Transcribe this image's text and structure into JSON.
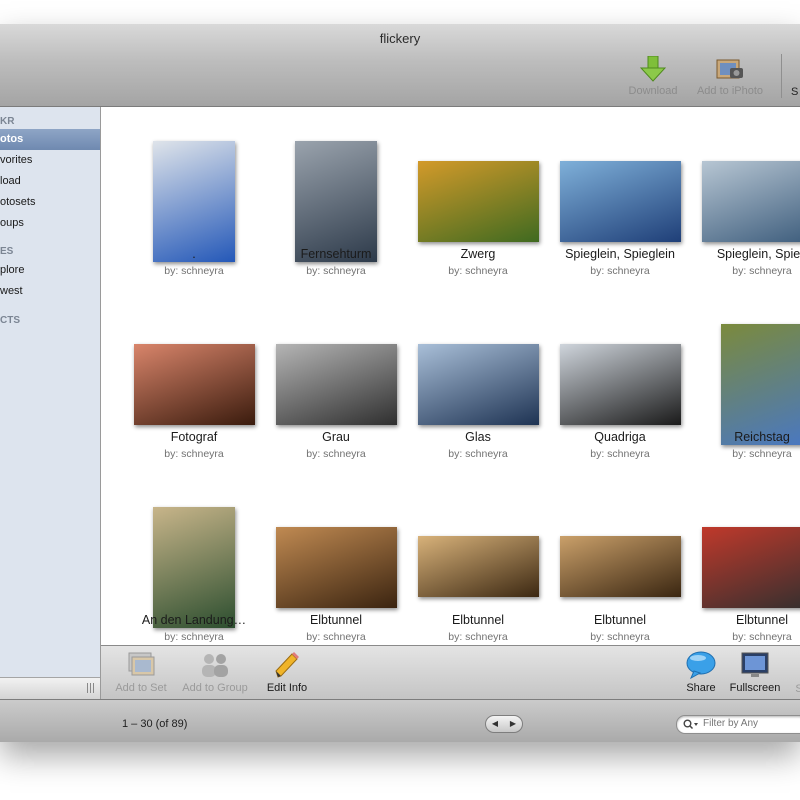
{
  "window": {
    "title": "flickery"
  },
  "toolbar": {
    "download_label": "Download",
    "add_to_iphoto_label": "Add to iPhoto",
    "overflow_label": "S"
  },
  "sidebar": {
    "sections": [
      {
        "label": "KR"
      },
      {
        "label": "ES"
      },
      {
        "label": "CTS"
      }
    ],
    "items": [
      {
        "label": "otos",
        "selected": true
      },
      {
        "label": "vorites"
      },
      {
        "label": "load"
      },
      {
        "label": "otosets"
      },
      {
        "label": "oups"
      },
      {
        "label": "plore"
      },
      {
        "label": "west"
      }
    ]
  },
  "photos": [
    {
      "title": ".",
      "owner": "by: schneyra",
      "colors": [
        "#2458b8",
        "#dfe4ea"
      ]
    },
    {
      "title": "Fernsehturm",
      "owner": "by: schneyra",
      "colors": [
        "#2d3a4a",
        "#9aa3ad"
      ]
    },
    {
      "title": "Zwerg",
      "owner": "by: schneyra",
      "colors": [
        "#3f6a20",
        "#d39a2a"
      ]
    },
    {
      "title": "Spieglein, Spieglein",
      "owner": "by: schneyra",
      "colors": [
        "#1f3f78",
        "#7fb0d9"
      ]
    },
    {
      "title": "Spieglein, Spieg",
      "owner": "by: schneyra",
      "colors": [
        "#3a5a7a",
        "#b7c6d3"
      ]
    },
    {
      "title": "Fotograf",
      "owner": "by: schneyra",
      "colors": [
        "#3a1b0d",
        "#d9856b"
      ]
    },
    {
      "title": "Grau",
      "owner": "by: schneyra",
      "colors": [
        "#2f2f2f",
        "#b5b5b5"
      ]
    },
    {
      "title": "Glas",
      "owner": "by: schneyra",
      "colors": [
        "#1e3353",
        "#a9bfd8"
      ]
    },
    {
      "title": "Quadriga",
      "owner": "by: schneyra",
      "colors": [
        "#1a1a1a",
        "#cfd5dc"
      ]
    },
    {
      "title": "Reichstag",
      "owner": "by: schneyra",
      "colors": [
        "#4a78c0",
        "#7b8a3c"
      ]
    },
    {
      "title": "An den Landung…",
      "owner": "by: schneyra",
      "colors": [
        "#2c4e2f",
        "#c8b58a"
      ]
    },
    {
      "title": "Elbtunnel",
      "owner": "by: schneyra",
      "colors": [
        "#3b2410",
        "#c08a52"
      ]
    },
    {
      "title": "Elbtunnel",
      "owner": "by: schneyra",
      "colors": [
        "#3c2812",
        "#d8b27a"
      ]
    },
    {
      "title": "Elbtunnel",
      "owner": "by: schneyra",
      "colors": [
        "#3a2611",
        "#caa06a"
      ]
    },
    {
      "title": "Elbtunnel",
      "owner": "by: schneyra",
      "colors": [
        "#2f2f2f",
        "#c0392b"
      ]
    }
  ],
  "bottom_toolbar": {
    "add_to_set": "Add to Set",
    "add_to_group": "Add to Group",
    "edit_info": "Edit Info",
    "share": "Share",
    "fullscreen": "Fullscreen",
    "overflow": "S"
  },
  "status": {
    "range_text": "1 – 30 (of 89)",
    "prev_arrow": "◀",
    "next_arrow": "▶"
  },
  "search": {
    "placeholder": "Filter by Any",
    "value": ""
  }
}
